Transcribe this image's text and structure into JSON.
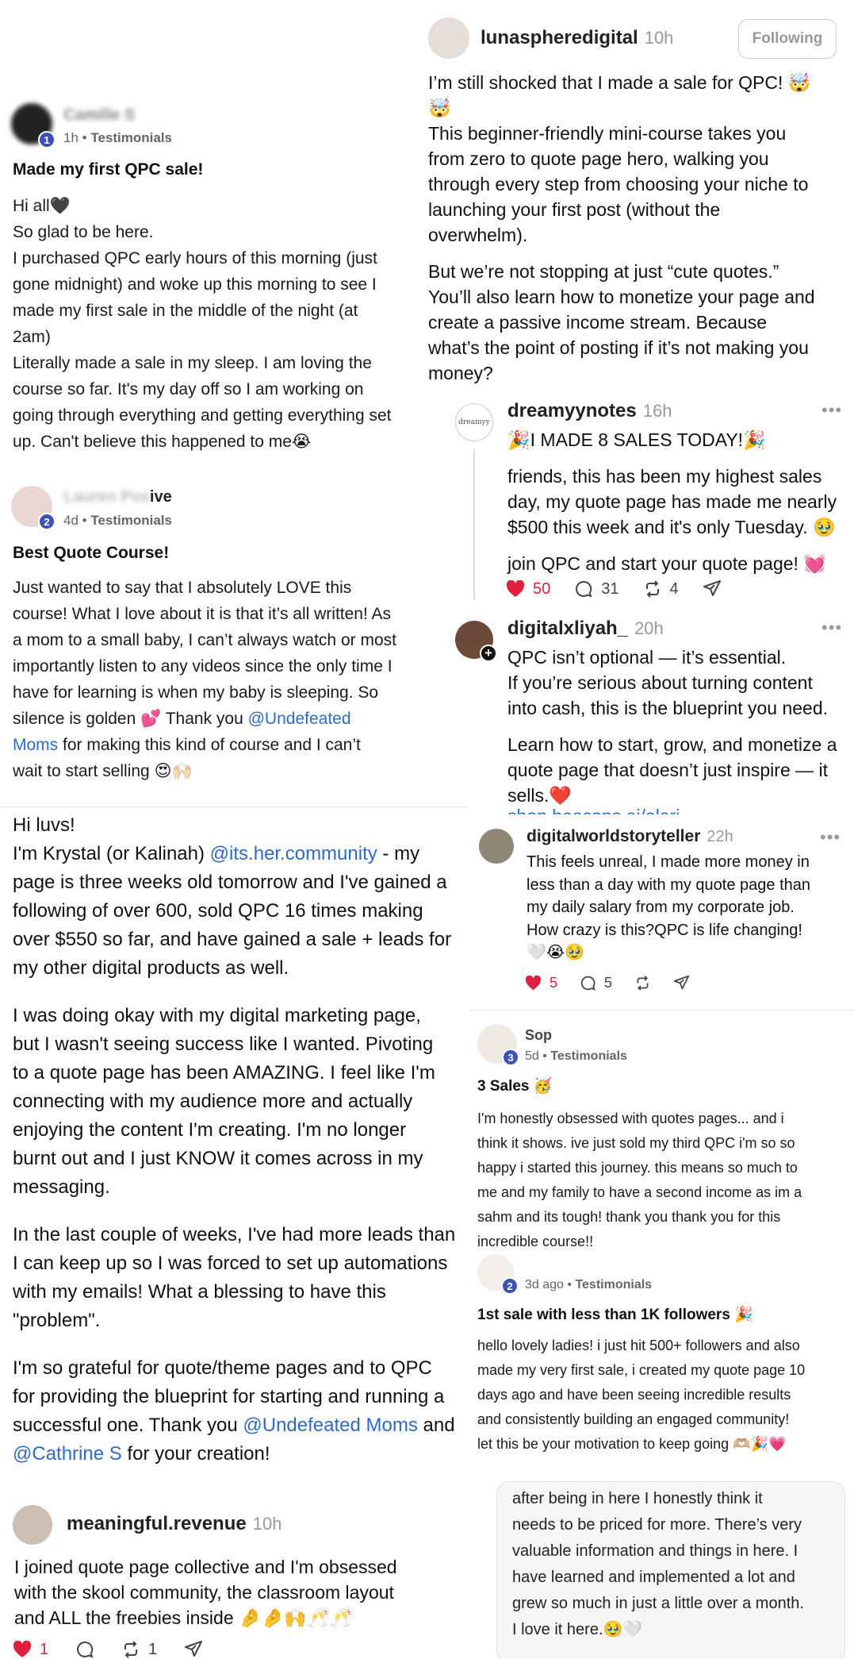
{
  "left": {
    "post1": {
      "author": "Camille S",
      "badge": "1",
      "time": "1h",
      "category": "Testimonials",
      "title": "Made my first QPC sale!",
      "lines": [
        "Hi all🖤",
        "So glad to be here.",
        "I purchased QPC early hours of this morning (just",
        "gone midnight) and woke up this morning to see I",
        "made my first sale in the middle of the night (at",
        "2am)",
        "Literally made a sale in my sleep. I am loving the",
        "course so far. It's my day off so I am working on",
        "going through everything and getting everything set",
        "up. Can't believe this happened to me😭"
      ]
    },
    "post2": {
      "author": "ive",
      "badge": "2",
      "time": "4d",
      "category": "Testimonials",
      "title": "Best Quote Course!",
      "lines": [
        "Just wanted to say that I absolutely LOVE this",
        "course! What I love about it is that it’s all written! As",
        "a mom to a small baby, I can’t always watch or most",
        "importantly listen to any videos since the only time I",
        "have for learning is when my baby is sleeping. So",
        "silence is golden 💕 Thank you "
      ],
      "mention": "@Undefeated",
      "line7_mention": "Moms",
      "line7_rest": " for making this kind of course and I can’t",
      "line8": "wait to start selling 😍🙌🏻"
    },
    "post3": {
      "p1_l1": "Hi luvs!",
      "p1_l2a": "I'm Krystal (or Kalinah) ",
      "p1_l2m": "@its.her.community",
      "p1_l2b": " - my",
      "p1_lines": [
        "page is three weeks old tomorrow and I've gained a",
        "following of over 600, sold QPC 16 times making",
        "over $550 so far, and have gained a sale + leads for",
        "my other digital products as well."
      ],
      "p2_lines": [
        "I was doing okay with my digital marketing page,",
        "but I wasn't seeing success like I wanted. Pivoting",
        "to a quote page has been AMAZING. I feel like I'm",
        "connecting with my audience more and actually",
        "enjoying the content I'm creating. I'm no longer",
        "burnt out and I just KNOW it comes across in my",
        "messaging."
      ],
      "p3_lines": [
        "In the last couple of weeks, I've had more leads than",
        "I can keep up so I was forced to set up automations",
        "with my emails! What a blessing to have this",
        "\"problem\"."
      ],
      "p4_l1": "I'm so grateful for quote/theme pages and to QPC",
      "p4_l2": "for providing the blueprint for starting and running a",
      "p4_l3a": "successful one. Thank you ",
      "p4_l3m": "@Undefeated Moms",
      "p4_l3b": " and",
      "p4_l4m": "@Cathrine S",
      "p4_l4b": " for your creation!"
    },
    "post4": {
      "username": "meaningful.revenue",
      "time": "10h",
      "lines": [
        "I joined quote page collective and I'm obsessed",
        "with the skool community, the classroom layout",
        "and ALL the freebies inside 🤌🤌🙌🥂🥂"
      ],
      "likes": "1",
      "reposts": "1"
    }
  },
  "right": {
    "post1": {
      "username": "lunaspheredigital",
      "time": "10h",
      "follow_label": "Following",
      "p1": [
        "I’m still shocked that I made a sale for QPC! 🤯",
        "🤯"
      ],
      "p2": [
        "This beginner-friendly mini-course takes you",
        "from zero to quote page hero, walking you",
        "through every step from choosing your niche to",
        "launching your first post (without the",
        "overwhelm)."
      ],
      "p3": [
        "But we’re not stopping at just “cute quotes.”",
        "You’ll also learn how to monetize your page and",
        "create a passive income stream. Because",
        "what’s the point of posting if it’s not making you",
        "money?"
      ]
    },
    "post2": {
      "username": "dreamyynotes",
      "avatar_text": "dreamyy",
      "time": "16h",
      "l1": "🎉I MADE 8 SALES TODAY!🎉",
      "p2": [
        "friends, this has been my highest sales",
        "day, my quote page has made me nearly",
        "$500 this week and it's only Tuesday. 🥹"
      ],
      "l3": "join QPC and start your quote page! 💓",
      "likes": "50",
      "comments": "31",
      "reposts": "4"
    },
    "post3": {
      "username": "digitalxliyah_",
      "time": "20h",
      "p1": [
        "QPC isn’t optional — it’s essential.",
        "If you’re serious about turning content",
        "into cash, this is the blueprint you need."
      ],
      "p2": [
        "Learn how to start, grow, and monetize a",
        "quote page that doesn’t just inspire — it",
        "sells.❤️"
      ],
      "link_cut": "shop.beacons.ai/alari"
    },
    "post4": {
      "username": "digitalworldstoryteller",
      "time": "22h",
      "lines": [
        "This feels unreal, I made more money in",
        "less than a day with my quote page than",
        "my daily salary from my corporate job.",
        "How crazy is this?QPC is life changing!",
        "🤍😭🥹"
      ],
      "likes": "5",
      "comments": "5"
    },
    "post5": {
      "author": "Sop",
      "badge": "3",
      "time": "5d",
      "category": "Testimonials",
      "title": "3 Sales 🥳",
      "lines": [
        "I'm honestly obsessed with quotes pages... and i",
        "think it shows. ive just sold my third QPC i'm so so",
        "happy i started this journey. this means so much to",
        "me and my family to have a second income as im a",
        "sahm and its tough! thank you thank you for this",
        "incredible course!!"
      ]
    },
    "post6": {
      "badge": "2",
      "time": "3d ago",
      "category": "Testimonials",
      "title": "1st sale with less than 1K followers 🎉",
      "lines": [
        "hello lovely ladies! i just hit 500+ followers and also",
        "made my very first sale, i created my quote page 10",
        "days ago and have been seeing incredible results",
        "and consistently building an engaged community!",
        "let this be your motivation to keep going 🫶🏼🎉💗"
      ]
    },
    "post7": {
      "lines": [
        "after being in here I honestly think it",
        "needs to be priced for more. There’s very",
        "valuable information and things in here. I",
        "have learned and implemented a lot and",
        "grew so much in just a little over a month.",
        "I love it here.🥹🤍"
      ]
    }
  },
  "colors": {
    "link": "#2d6bc4",
    "like": "#e02040",
    "badge": "#3f51b5"
  },
  "icons": [
    "heart-icon",
    "comment-icon",
    "repost-icon",
    "share-icon",
    "more-icon"
  ]
}
